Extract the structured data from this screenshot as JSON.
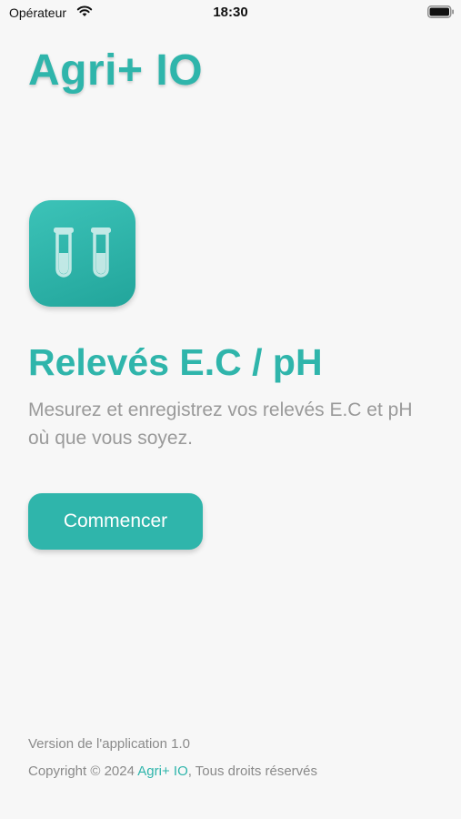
{
  "status_bar": {
    "carrier": "Opérateur",
    "time": "18:30",
    "wifi_icon": "wifi-icon",
    "battery_icon": "battery-icon"
  },
  "header": {
    "app_title": "Agri+ IO"
  },
  "feature": {
    "icon": "test-tubes-icon",
    "title": "Relevés E.C / pH",
    "description": "Mesurez et enregistrez vos relevés E.C et pH où que vous soyez."
  },
  "actions": {
    "start_label": "Commencer"
  },
  "footer": {
    "version": "Version de l'application 1.0",
    "copyright_prefix": "Copyright © 2024 ",
    "brand": "Agri+ IO",
    "copyright_suffix": ", Tous droits réservés"
  },
  "colors": {
    "accent": "#2fb5ab",
    "background": "#f7f7f7",
    "muted_text": "#9a9a9a"
  }
}
